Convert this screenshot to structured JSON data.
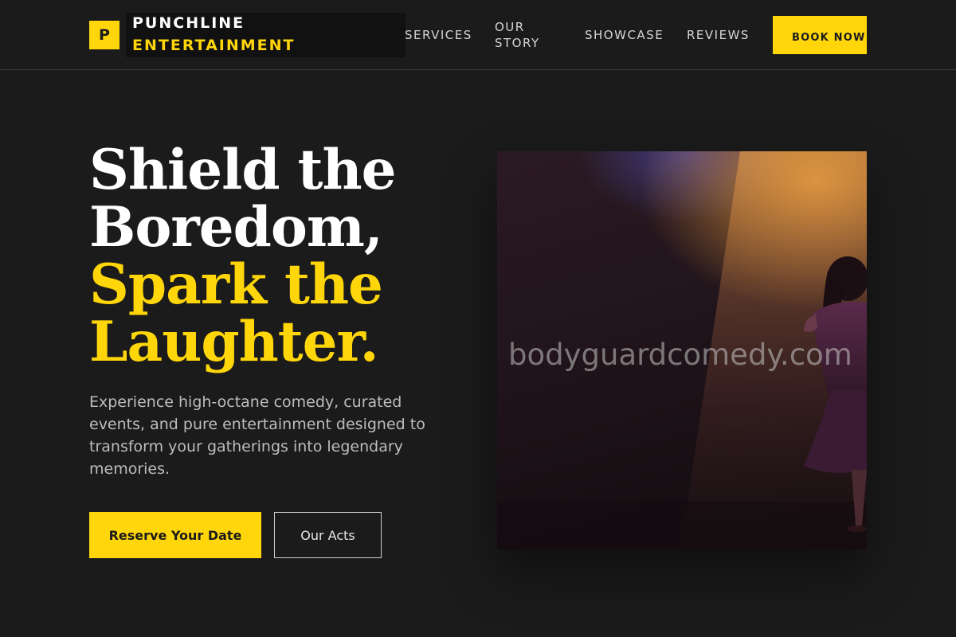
{
  "brand": {
    "mark": "P",
    "name_line1": "PUNCHLINE",
    "name_line2": "ENTERTAINMENT"
  },
  "nav": {
    "services": "SERVICES",
    "story": "OUR STORY",
    "showcase": "SHOWCASE",
    "reviews": "REVIEWS",
    "book": "BOOK NOW"
  },
  "hero": {
    "headline_line1": "Shield the",
    "headline_line2": "Boredom,",
    "headline_line3": "Spark the",
    "headline_line4": "Laughter.",
    "subtext": "Experience high-octane comedy, curated events, and pure entertainment designed to transform your gatherings into legendary memories.",
    "primary_cta": "Reserve Your Date",
    "secondary_cta": "Our Acts",
    "image_watermark": "bodyguardcomedy.com"
  },
  "colors": {
    "background": "#1b1b1b",
    "accent": "#ffd60a",
    "text_primary": "#ffffff",
    "text_muted": "#bdbdbd"
  },
  "icons": {
    "logo": "letter-p-logo"
  }
}
